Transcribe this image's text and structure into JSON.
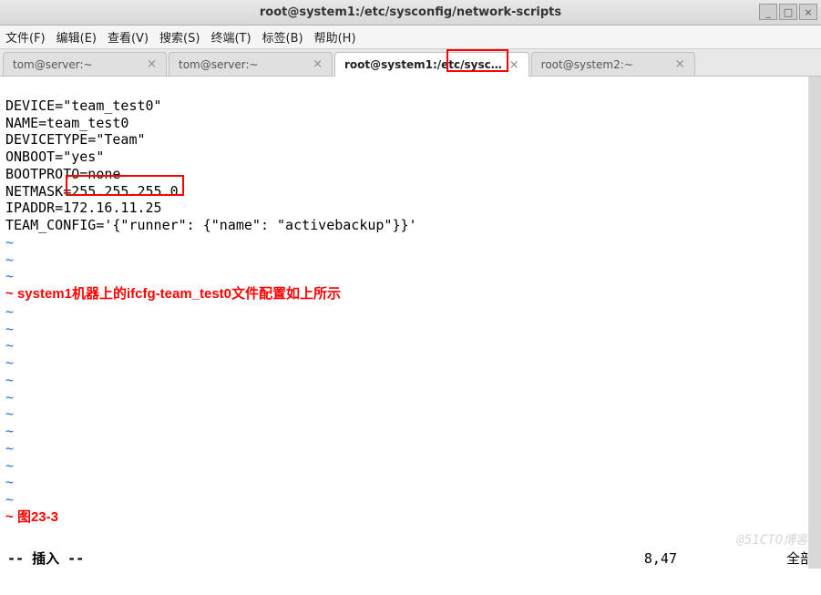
{
  "window": {
    "title": "root@system1:/etc/sysconfig/network-scripts",
    "controls": {
      "min": "_",
      "max": "□",
      "close": "×"
    }
  },
  "menu": {
    "file": "文件(F)",
    "edit": "编辑(E)",
    "view": "查看(V)",
    "search": "搜索(S)",
    "terminal": "终端(T)",
    "tabs": "标签(B)",
    "help": "帮助(H)"
  },
  "tabs": [
    {
      "label": "tom@server:~",
      "active": false
    },
    {
      "label": "tom@server:~",
      "active": false
    },
    {
      "label": "root@system1:/etc/sysc…",
      "active": true
    },
    {
      "label": "root@system2:~",
      "active": false
    }
  ],
  "content": {
    "lines": [
      "DEVICE=\"team_test0\"",
      "NAME=team_test0",
      "DEVICETYPE=\"Team\"",
      "ONBOOT=\"yes\"",
      "BOOTPROTO=none",
      "NETMASK=255.255.255.0",
      "IPADDR=172.16.11.25",
      "TEAM_CONFIG='{\"runner\": {\"name\": \"activebackup\"}}'"
    ],
    "annotation": "system1机器上的ifcfg-team_test0文件配置如上所示",
    "figure_label": "图23-3"
  },
  "status": {
    "mode": "-- 插入 --",
    "position": "8,47",
    "scroll": "全部"
  },
  "watermark": "@51CTO博客",
  "highlight": {
    "tab_word": "system1",
    "ipaddr_value": "172.16.11.25"
  }
}
